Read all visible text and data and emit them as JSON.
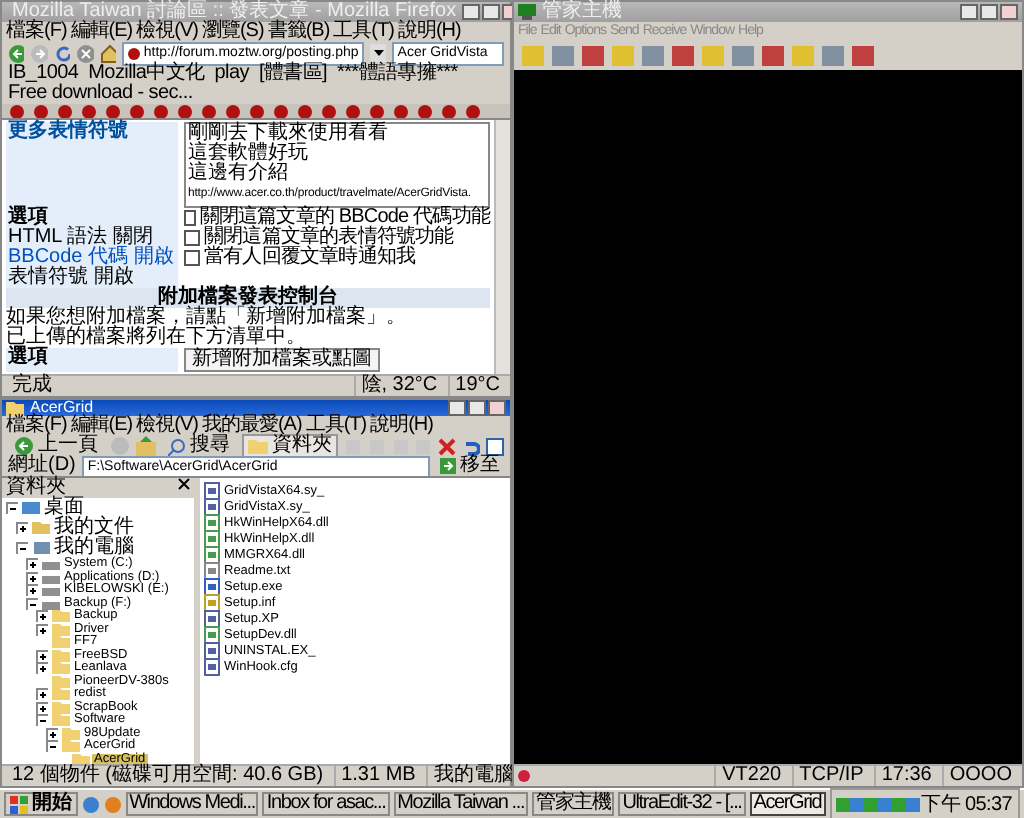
{
  "browser": {
    "title": "Mozilla Taiwan 討論區 :: 發表文章 - Mozilla Firefox",
    "menu": [
      "檔案(F)",
      "編輯(E)",
      "檢視(V)",
      "瀏覽(S)",
      "書籤(B)",
      "工具(T)",
      "說明(H)"
    ],
    "url": "http://forum.moztw.org/posting.php",
    "search": "Acer GridVista",
    "bookmarks": [
      "IB_1004",
      "Mozilla中文化",
      "play",
      "[體書區]",
      "***體語專擁***",
      "Free download - sec..."
    ],
    "sidebar_link": "更多表情符號",
    "message_lines": [
      "剛剛去下載來使用看看",
      "這套軟體好玩",
      "這邊有介紹",
      "http://www.acer.co.th/product/travelmate/AcerGridVista."
    ],
    "options_heading": "選項",
    "settings": [
      {
        "label": "HTML 語法 關閉",
        "link": false
      },
      {
        "label": "BBCode 代碼 開啟",
        "link": true
      },
      {
        "label": "表情符號 開啟",
        "link": false
      }
    ],
    "checkboxes": [
      {
        "label": "關閉這篇文章的 BBCode 代碼功能",
        "checked": false
      },
      {
        "label": "關閉這篇文章的表情符號功能",
        "checked": false
      },
      {
        "label": "當有人回覆文章時通知我",
        "checked": false
      }
    ],
    "attach_heading": "附加檔案發表控制台",
    "attach_notes": [
      "如果您想附加檔案，請點「新增附加檔案」。",
      "已上傳的檔案將列在下方清單中。"
    ],
    "attach_label": "選項",
    "attach_button": "新增附加檔案或點圖",
    "status": "完成",
    "weather": [
      "陰, 32°C",
      "19°C"
    ]
  },
  "explorer": {
    "title": "AcerGrid",
    "menu": [
      "檔案(F)",
      "編輯(E)",
      "檢視(V)",
      "我的最愛(A)",
      "工具(T)",
      "說明(H)"
    ],
    "back": "上一頁",
    "search": "搜尋",
    "folders": "資料夾",
    "address_label": "網址(D)",
    "path": "F:\\Software\\AcerGrid\\AcerGrid",
    "go": "移至",
    "pane_title": "資料夾",
    "tree": [
      {
        "label": "桌面",
        "kind": "desktop",
        "selected": false,
        "children": [
          {
            "label": "我的文件",
            "kind": "documents",
            "selected": false,
            "expanded": false
          },
          {
            "label": "我的電腦",
            "kind": "computer",
            "selected": false,
            "children": [
              {
                "label": "System (C:)",
                "kind": "drive",
                "selected": false,
                "expanded": false
              },
              {
                "label": "Applications (D:)",
                "kind": "drive",
                "selected": false,
                "expanded": false
              },
              {
                "label": "KIBELOWSKI (E:)",
                "kind": "drive",
                "selected": false,
                "expanded": false
              },
              {
                "label": "Backup (F:)",
                "kind": "drive",
                "selected": false,
                "children": [
                  {
                    "label": "Backup",
                    "kind": "folder",
                    "selected": false,
                    "expanded": false
                  },
                  {
                    "label": "Driver",
                    "kind": "folder",
                    "selected": false,
                    "expanded": false
                  },
                  {
                    "label": "FF7",
                    "kind": "folder",
                    "selected": false
                  },
                  {
                    "label": "FreeBSD",
                    "kind": "folder",
                    "selected": false,
                    "expanded": false
                  },
                  {
                    "label": "Leanlava",
                    "kind": "folder",
                    "selected": false,
                    "expanded": false
                  },
                  {
                    "label": "PioneerDV-380s",
                    "kind": "folder",
                    "selected": false
                  },
                  {
                    "label": "redist",
                    "kind": "folder",
                    "selected": false,
                    "expanded": false
                  },
                  {
                    "label": "ScrapBook",
                    "kind": "folder",
                    "selected": false,
                    "expanded": false
                  },
                  {
                    "label": "Software",
                    "kind": "folder",
                    "selected": false,
                    "children": [
                      {
                        "label": "98Update",
                        "kind": "folder",
                        "selected": false,
                        "expanded": false
                      },
                      {
                        "label": "AcerGrid",
                        "kind": "folder",
                        "selected": false,
                        "children": [
                          {
                            "label": "AcerGrid",
                            "kind": "folder",
                            "selected": true
                          }
                        ]
                      }
                    ]
                  }
                ]
              }
            ]
          }
        ]
      }
    ],
    "files": [
      {
        "name": "GridVistaX64.sy_",
        "kind": "file"
      },
      {
        "name": "GridVistaX.sy_",
        "kind": "file"
      },
      {
        "name": "HkWinHelpX64.dll",
        "kind": "dll"
      },
      {
        "name": "HkWinHelpX.dll",
        "kind": "dll"
      },
      {
        "name": "MMGRX64.dll",
        "kind": "dll"
      },
      {
        "name": "Readme.txt",
        "kind": "text"
      },
      {
        "name": "Setup.exe",
        "kind": "exe"
      },
      {
        "name": "Setup.inf",
        "kind": "inf"
      },
      {
        "name": "Setup.XP",
        "kind": "file"
      },
      {
        "name": "SetupDev.dll",
        "kind": "dll"
      },
      {
        "name": "UNINSTAL.EX_",
        "kind": "file"
      },
      {
        "name": "WinHook.cfg",
        "kind": "file"
      }
    ],
    "status": [
      "12 個物件 (磁碟可用空間: 40.6 GB)",
      "1.31 MB",
      "我的電腦"
    ]
  },
  "terminal": {
    "title": "管家主機",
    "menu": [
      "File",
      "Edit",
      "Options",
      "Send",
      "Receive",
      "Window",
      "Help"
    ],
    "status": [
      "VT220",
      "TCP/IP",
      "17:36",
      "OOOO"
    ]
  },
  "taskbar": {
    "start": "開始",
    "tasks": [
      {
        "label": "Windows Medi...",
        "selected": false
      },
      {
        "label": "Inbox for asac...",
        "selected": false
      },
      {
        "label": "Mozilla Taiwan ...",
        "selected": false
      },
      {
        "label": "管家主機",
        "selected": false
      },
      {
        "label": "UltraEdit-32 - [...",
        "selected": false
      },
      {
        "label": "AcerGrid",
        "selected": true
      }
    ],
    "clock": "下午 05:37"
  }
}
